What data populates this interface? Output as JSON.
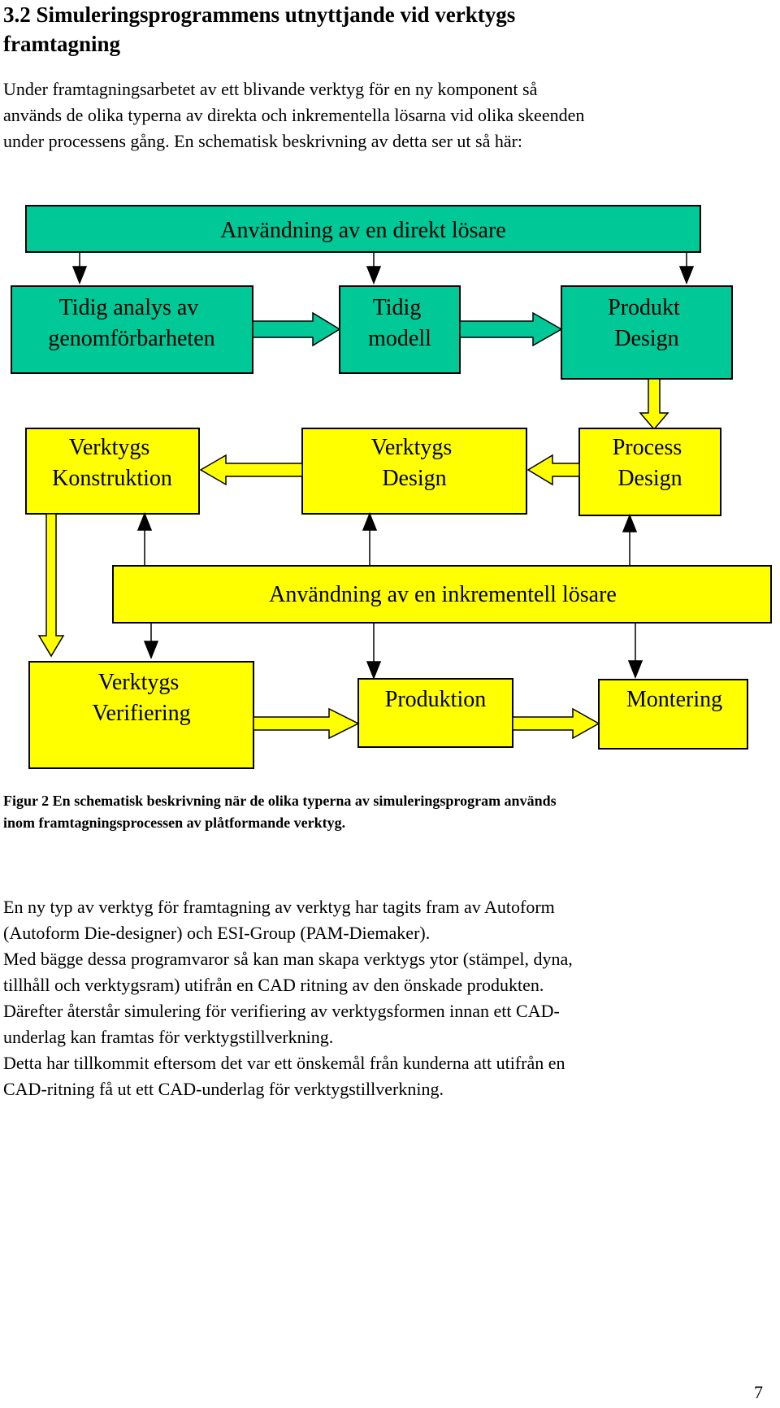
{
  "heading": {
    "lines": [
      "3.2 Simuleringsprogrammens utnyttjande vid verktygs",
      "framtagning"
    ]
  },
  "intro": {
    "lines": [
      "Under framtagningsarbetet av ett blivande verktyg för en ny komponent så",
      "används de olika typerna av direkta och inkrementella lösarna vid olika skeenden",
      "under processens gång. En schematisk beskrivning av detta ser ut så här:"
    ]
  },
  "diagram": {
    "colors": {
      "green": "#00C896",
      "yellow": "#FFFF00",
      "stroke": "#000000"
    },
    "direct_solver": {
      "label": "Användning av en direkt lösare"
    },
    "early_analysis": {
      "lines": [
        "Tidig analys av",
        "genomförbarheten"
      ]
    },
    "early_model": {
      "lines": [
        "Tidig",
        "modell"
      ]
    },
    "product_design": {
      "lines": [
        "Produkt",
        "Design"
      ]
    },
    "tool_construction": {
      "lines": [
        "Verktygs",
        "Konstruktion"
      ]
    },
    "tool_design": {
      "lines": [
        "Verktygs",
        "Design"
      ]
    },
    "process_design": {
      "lines": [
        "Process",
        "Design"
      ]
    },
    "incremental_solver": {
      "label": "Användning av en inkrementell lösare"
    },
    "tool_verification": {
      "lines": [
        "Verktygs",
        "Verifiering"
      ]
    },
    "production": {
      "label": "Produktion"
    },
    "assembly": {
      "label": "Montering"
    }
  },
  "caption": {
    "lines": [
      "Figur 2 En schematisk beskrivning när de olika typerna av simuleringsprogram används",
      "inom framtagningsprocessen av plåtformande verktyg."
    ]
  },
  "body": {
    "lines": [
      "En ny typ av verktyg för framtagning av verktyg har tagits fram av Autoform",
      "(Autoform Die-designer) och ESI-Group (PAM-Diemaker).",
      "Med bägge dessa programvaror så kan man skapa verktygs ytor (stämpel, dyna,",
      "tillhåll och verktygsram) utifrån en CAD ritning av den önskade produkten.",
      "Därefter återstår simulering för verifiering av verktygsformen innan ett CAD-",
      "underlag kan framtas för verktygstillverkning.",
      "Detta har tillkommit eftersom det var ett önskemål från kunderna att utifrån en",
      "CAD-ritning få ut ett CAD-underlag för verktygstillverkning."
    ]
  },
  "page_number": "7"
}
